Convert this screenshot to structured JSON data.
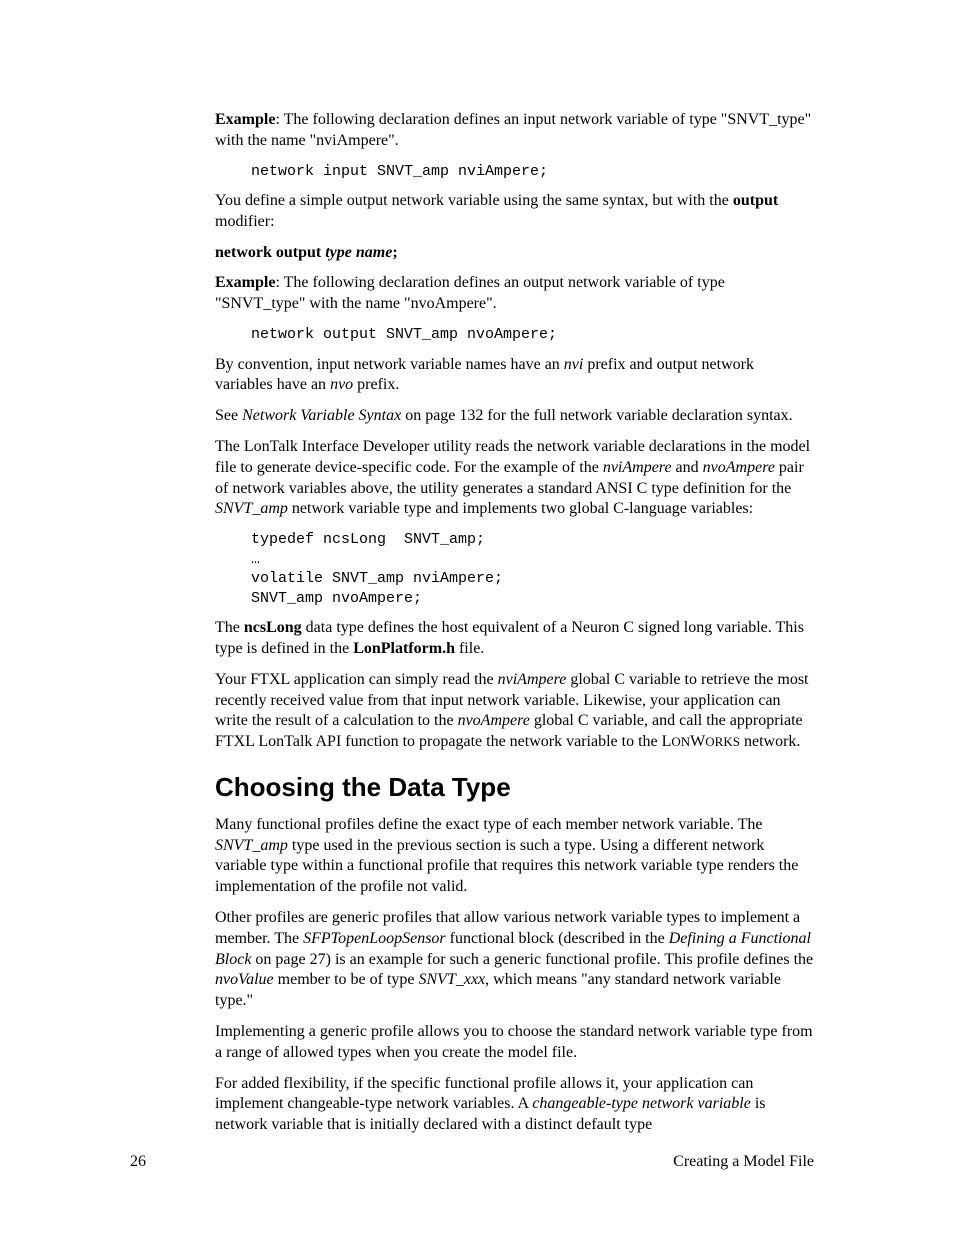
{
  "p1_a": "Example",
  "p1_b": ":  The following declaration defines an input network variable of type \"SNVT_type\" with the name \"nviAmpere\".",
  "code1": "network input SNVT_amp nviAmpere;",
  "p2_a": "You define a simple output network variable using the same syntax, but with the ",
  "p2_b": "output",
  "p2_c": " modifier:",
  "p3_a": "network output ",
  "p3_b": "type name",
  "p3_c": ";",
  "p4_a": "Example",
  "p4_b": ":  The following declaration defines an output network variable of type \"SNVT_type\" with the name \"nvoAmpere\".",
  "code2": "network output SNVT_amp nvoAmpere;",
  "p5_a": "By convention, input network variable names have an ",
  "p5_b": "nvi",
  "p5_c": " prefix and output network variables have an ",
  "p5_d": "nvo",
  "p5_e": " prefix.",
  "p6_a": "See ",
  "p6_b": "Network Variable Syntax",
  "p6_c": " on page 132 for the full network variable declaration syntax.",
  "p7_a": "The LonTalk Interface Developer utility reads the network variable declarations in the model file to generate device-specific code.  For the example of the ",
  "p7_b": "nviAmpere",
  "p7_c": " and ",
  "p7_d": "nvoAmpere",
  "p7_e": " pair of network variables above, the utility generates a standard ANSI C type definition for the ",
  "p7_f": "SNVT_amp",
  "p7_g": " network variable type and implements two global C-language variables:",
  "code3": "typedef ncsLong  SNVT_amp;\n…\nvolatile SNVT_amp nviAmpere;\nSNVT_amp nvoAmpere;",
  "p8_a": "The ",
  "p8_b": "ncsLong",
  "p8_c": " data type defines the host equivalent of a Neuron C signed long variable.  This type is defined in the ",
  "p8_d": "LonPlatform.h",
  "p8_e": " file.",
  "p9_a": "Your FTXL application can simply read the ",
  "p9_b": "nviAmpere",
  "p9_c": " global C variable to retrieve the most recently received value from that input network variable.  Likewise, your application can write the result of a calculation to the ",
  "p9_d": "nvoAmpere",
  "p9_e": " global C variable, and call the appropriate FTXL LonTalk API function to propagate the network variable to the L",
  "p9_f": "ON",
  "p9_g": "W",
  "p9_h": "ORKS",
  "p9_i": " network.",
  "h2": "Choosing the Data Type",
  "s1_a": "Many functional profiles define the exact type of each member network variable.  The ",
  "s1_b": "SNVT_amp",
  "s1_c": " type used in the previous section is such a type.  Using a different network variable type within a functional profile that requires this network variable type renders the implementation of the profile not valid.",
  "s2_a": "Other profiles are generic profiles that allow various network variable types to implement a member.  The ",
  "s2_b": "SFPTopenLoopSensor",
  "s2_c": " functional block (described in the ",
  "s2_d": "Defining a Functional Block",
  "s2_e": " on page 27) is an example for such a generic functional profile.  This profile defines the ",
  "s2_f": "nvoValue",
  "s2_g": " member to be of type ",
  "s2_h": "SNVT_xxx",
  "s2_i": ", which means \"any standard network variable type.\"",
  "s3": "Implementing a generic profile allows you to choose the standard network variable type from a range of allowed types when you create the model file.",
  "s4_a": "For added flexibility, if the specific functional profile allows it, your application can implement changeable-type network variables.  A ",
  "s4_b": "changeable-type network variable",
  "s4_c": " is network variable that is initially declared with a distinct default type",
  "footer_left": "26",
  "footer_right": "Creating a Model File"
}
